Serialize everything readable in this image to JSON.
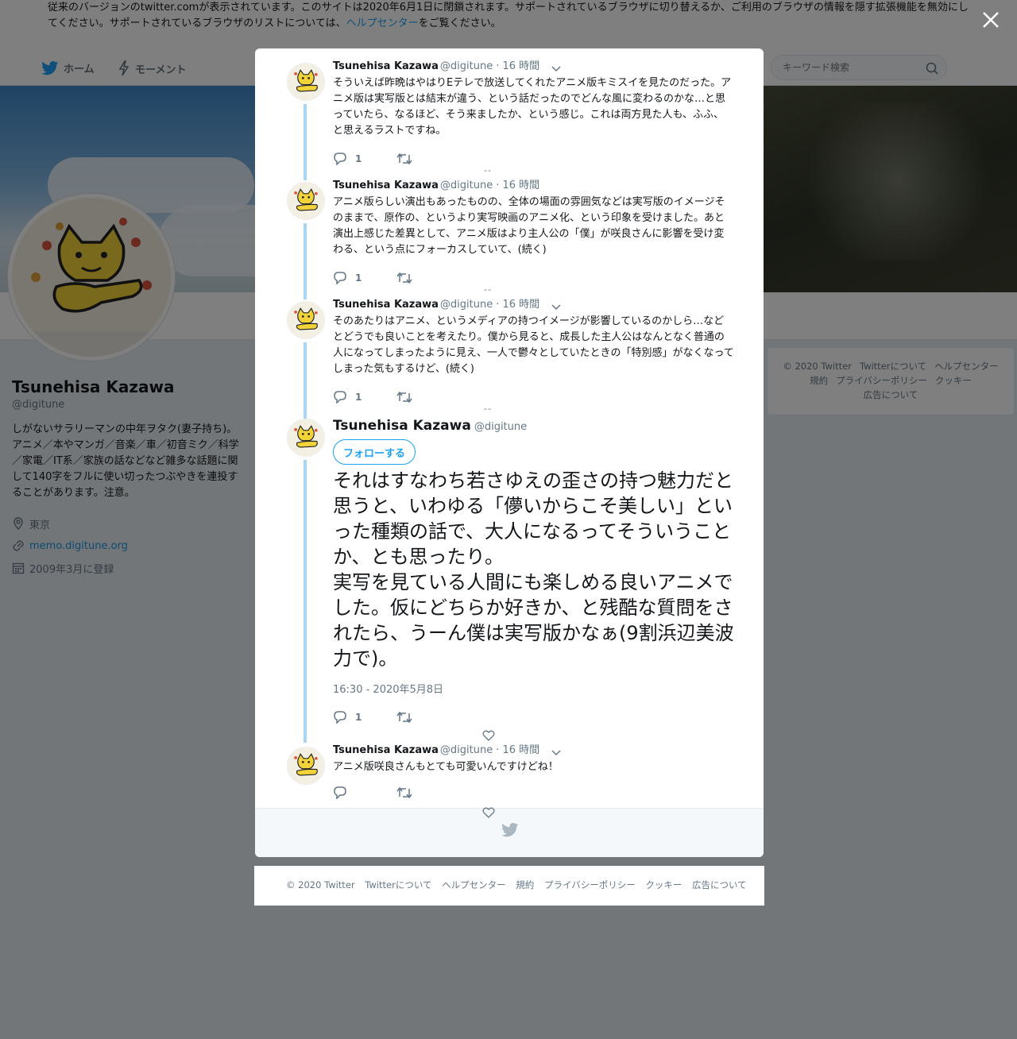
{
  "notice": {
    "text_before": "従来のバージョンのtwitter.comが表示されています。このサイトは2020年6月1日に閉鎖されます。サポートされているブラウザに切り替えるか、ご利用のブラウザの情報を隠す拡張機能を無効にしてください。サポートされているブラウザのリストについては、",
    "link": "ヘルプセンター",
    "text_after": "をご覧ください。"
  },
  "nav": {
    "home": "ホーム",
    "moments": "モーメント"
  },
  "search": {
    "placeholder": "キーワード検索"
  },
  "profile": {
    "name": "Tsunehisa Kazawa",
    "handle": "@digitune",
    "bio": "しがないサラリーマンの中年ヲタク(妻子持ち)。アニメ／本やマンガ／音楽／車／初音ミク／科学／家電／IT系／家族の話などなど雑多な話題に関して140字をフルに使い切ったつぶやきを連投することがあります。注意。",
    "location": "東京",
    "url": "memo.digitune.org",
    "joined": "2009年3月に登録"
  },
  "side_footer": [
    "© 2020 Twitter",
    "Twitterについて",
    "ヘルプセンター",
    "規約",
    "プライバシーポリシー",
    "クッキー",
    "広告について"
  ],
  "tweets": [
    {
      "name": "Tsunehisa Kazawa",
      "handle": "@digitune",
      "time": "· 16 時間",
      "text": "そういえば昨晩はやはりEテレで放送してくれたアニメ版キミスイを見たのだった。アニメ版は実写版とは結末が違う、という話だったのでどんな風に変わるのかな…と思っていたら、なるほど、そう来ましたか、という感じ。これは両方見た人も、ふふ、と思えるラストですね。",
      "replies": "1"
    },
    {
      "name": "Tsunehisa Kazawa",
      "handle": "@digitune",
      "time": "· 16 時間",
      "text": "アニメ版らしい演出もあったものの、全体の場面の雰囲気などは実写版のイメージそのままで、原作の、というより実写映画のアニメ化、という印象を受けました。あと演出上感じた差異として、アニメ版はより主人公の「僕」が咲良さんに影響を受け変わる、という点にフォーカスしていて、(続く)",
      "replies": "1"
    },
    {
      "name": "Tsunehisa Kazawa",
      "handle": "@digitune",
      "time": "· 16 時間",
      "text": "そのあたりはアニメ、というメディアの持つイメージが影響しているのかしら…などとどうでも良いことを考えたり。僕から見ると、成長した主人公はなんとなく普通の人になってしまったように見え、一人で鬱々としていたときの「特別感」がなくなってしまった気もするけど、(続く)",
      "replies": "1"
    }
  ],
  "main_tweet": {
    "name": "Tsunehisa Kazawa",
    "handle": "@digitune",
    "follow": "フォローする",
    "text_line1": "それはすなわち若さゆえの歪さの持つ魅力だと思うと、いわゆる「儚いからこそ美しい」といった種類の話で、大人になるってそういうことか、とも思ったり。",
    "text_line2": "実写を見ている人間にも楽しめる良いアニメでした。仮にどちらか好きか、と残酷な質問をされたら、うーん僕は実写版かなぁ(9割浜辺美波力で)。",
    "date": "16:30 - 2020年5月8日",
    "replies": "1"
  },
  "reply_tweet": {
    "name": "Tsunehisa Kazawa",
    "handle": "@digitune",
    "time": "· 16 時間",
    "text": "アニメ版咲良さんもとても可愛いんですけどね！"
  },
  "dashes": "--",
  "bottom_footer": [
    "© 2020 Twitter",
    "Twitterについて",
    "ヘルプセンター",
    "規約",
    "プライバシーポリシー",
    "クッキー",
    "広告について"
  ],
  "colors": {
    "accent": "#1da1f2",
    "thread": "#a8d6f5",
    "overlay": "rgba(0,0,0,0.5)"
  }
}
